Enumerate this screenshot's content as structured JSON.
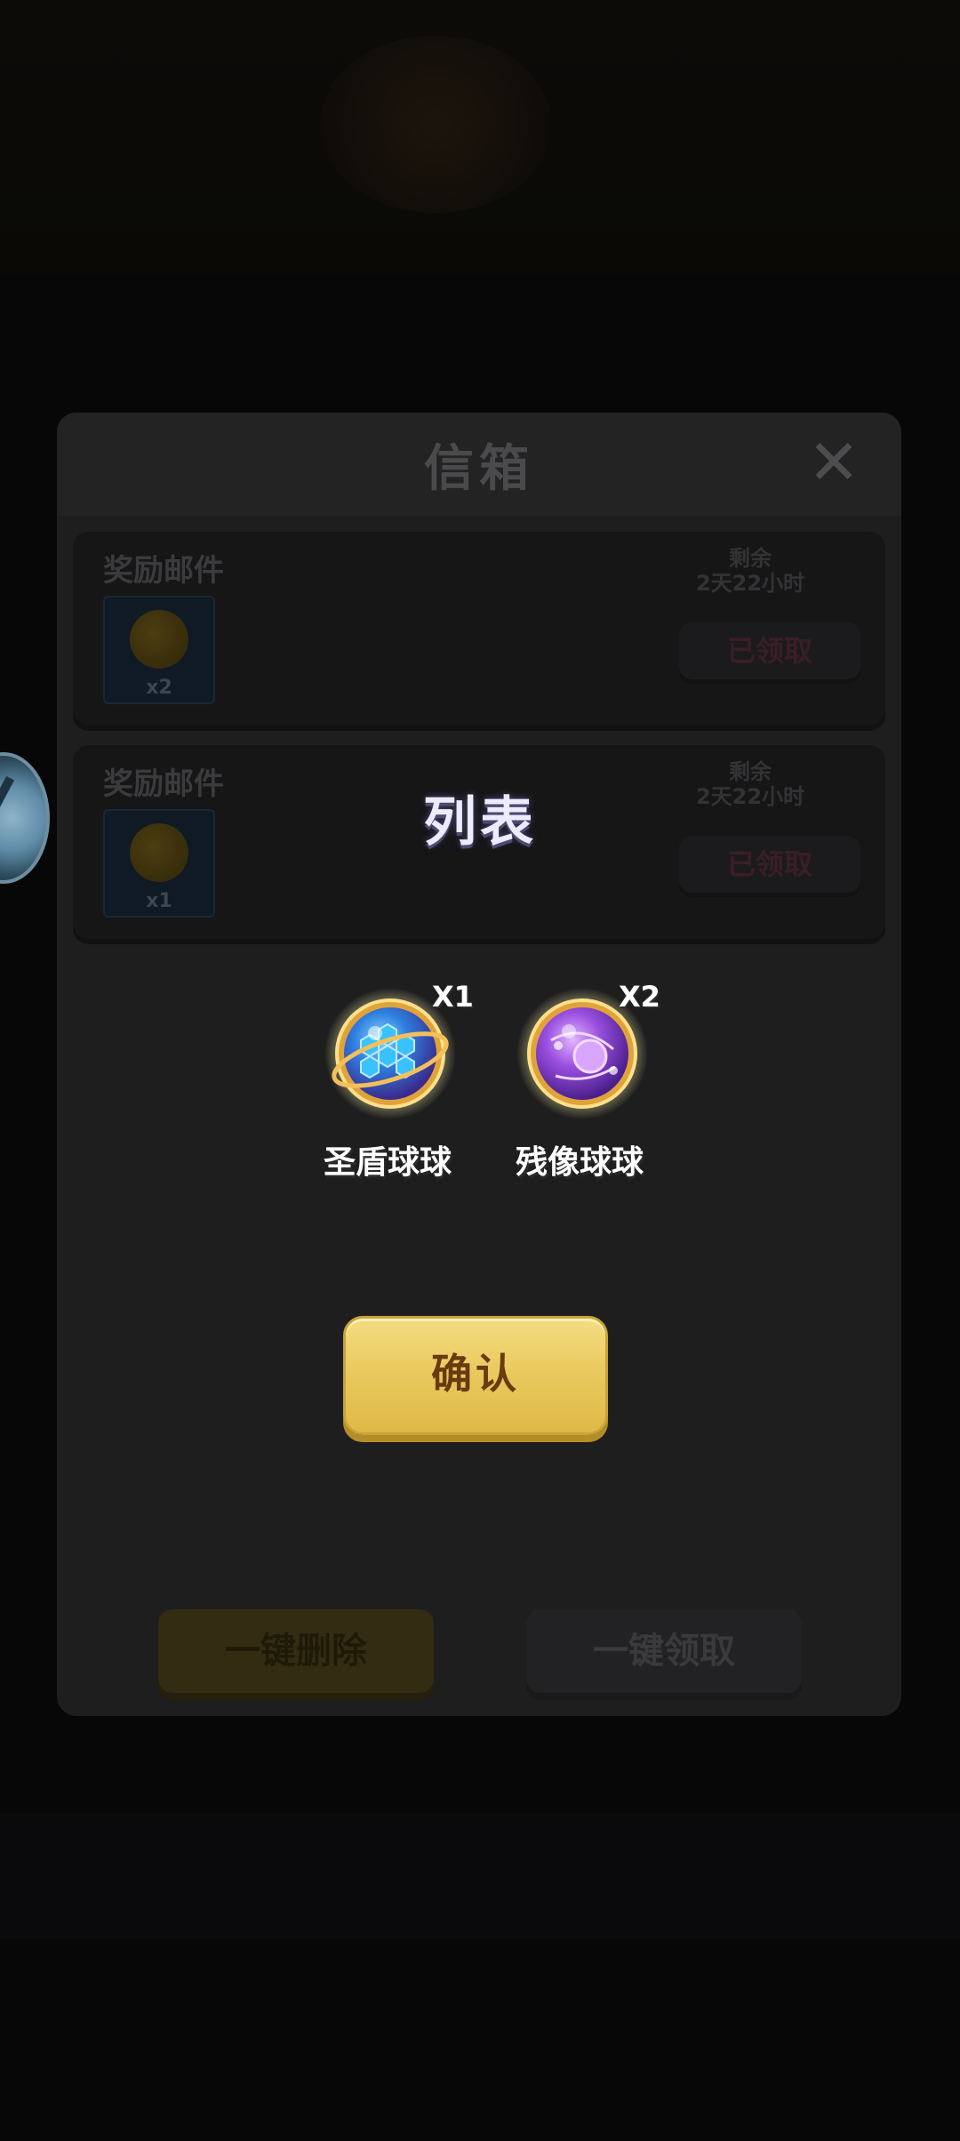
{
  "mailbox": {
    "title": "信箱",
    "close_icon": "close-icon",
    "mails": [
      {
        "title": "奖励邮件",
        "item_count": "x2",
        "remaining_label": "剩余",
        "remaining_time": "2天22小时",
        "status": "已领取"
      },
      {
        "title": "奖励邮件",
        "item_count": "x1",
        "remaining_label": "剩余",
        "remaining_time": "2天22小时",
        "status": "已领取"
      }
    ],
    "delete_all": "一键删除",
    "claim_all": "一键领取"
  },
  "popup": {
    "title": "列表",
    "rewards": [
      {
        "name": "圣盾球球",
        "count": "X1",
        "icon": "blue-hex-orb-icon"
      },
      {
        "name": "残像球球",
        "count": "X2",
        "icon": "purple-orb-icon"
      }
    ],
    "confirm": "确认"
  },
  "colors": {
    "confirm_button": "#e8c75a",
    "popup_title": "#ecebff"
  }
}
